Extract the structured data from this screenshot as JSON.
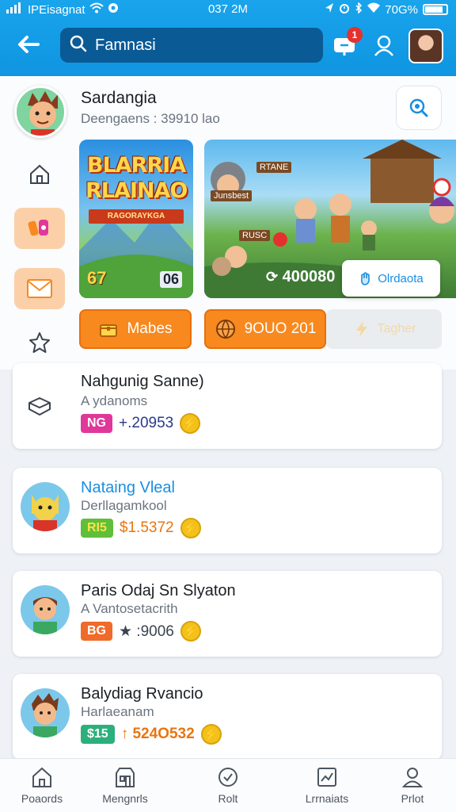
{
  "status_bar": {
    "carrier": "IPEisagnat",
    "time": "037 2M",
    "battery": "70G%"
  },
  "topbar": {
    "search_value": "Famnasi",
    "notification_count": "1"
  },
  "header": {
    "title": "Sardangia",
    "subtitle": "Deengaens : 39910 lao"
  },
  "banners": {
    "left": {
      "title_line1": "BLARRIA",
      "title_line2": "RLAINAO",
      "ribbon": "RAGORAYKGA",
      "num_left": "67",
      "num_right": "06"
    },
    "right": {
      "sign1": "RTANE",
      "sign2": "Junsbest",
      "sign3": "RUSC",
      "score": "400080",
      "button_label": "Olrdaota"
    }
  },
  "actions": {
    "matches_label": "Mabes",
    "score_label": "9OUO 201",
    "faded_label": "Tagher"
  },
  "cards": [
    {
      "name": "Nahgunig Sanne)",
      "sub": "A ydanoms",
      "tag": "NG",
      "value": "+.20953"
    },
    {
      "name": "Nataing Vleal",
      "sub": "Derllagamkool",
      "tag": "RI5",
      "value": "$1.5372"
    },
    {
      "name": "Paris Odaj Sn Slyaton",
      "sub": "A Vantosetacrith",
      "tag": "BG",
      "value": "★ :9006"
    },
    {
      "name": "Balydiag Rvancio",
      "sub": "Harlaeanam",
      "tag": "$15",
      "value": "↑ 524O532"
    }
  ],
  "bottom_nav": [
    {
      "label": "Poaords"
    },
    {
      "label": "Mengnrls"
    },
    {
      "label": "Rolt"
    },
    {
      "label": "Lrrnaiats"
    },
    {
      "label": "Prlot"
    }
  ],
  "colors": {
    "top_blue": "#12a0e8",
    "accent_orange": "#f7891f",
    "pink_tag": "#e0379a",
    "green_tag": "#5fbf3a",
    "red_tag": "#f06a2a",
    "teal_tag": "#2bb07c"
  }
}
